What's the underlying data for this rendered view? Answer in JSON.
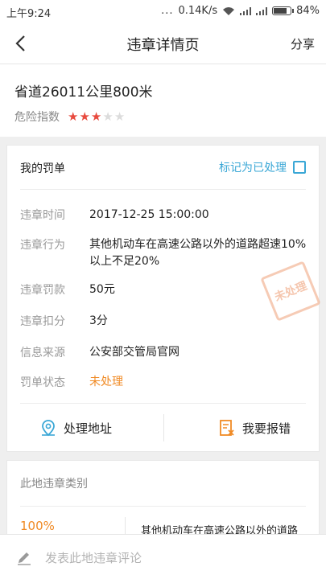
{
  "status_bar": {
    "time": "上午9:24",
    "dots": "...",
    "speed": "0.14K/s",
    "battery": "84%",
    "battery_level": 0.84
  },
  "nav": {
    "title": "违章详情页",
    "share": "分享"
  },
  "location": {
    "name": "省道26011公里800米",
    "risk_label": "危险指数",
    "risk_level": 3,
    "risk_max": 5
  },
  "ticket": {
    "header": "我的罚单",
    "mark_label": "标记为已处理",
    "stamp": "未处理",
    "rows": [
      {
        "label": "违章时间",
        "value": "2017-12-25 15:00:00"
      },
      {
        "label": "违章行为",
        "value": "其他机动车在高速公路以外的道路超速10%以上不足20%"
      },
      {
        "label": "违章罚款",
        "value": "50元"
      },
      {
        "label": "违章扣分",
        "value": "3分"
      },
      {
        "label": "信息来源",
        "value": "公安部交管局官网"
      },
      {
        "label": "罚单状态",
        "value": "未处理"
      }
    ],
    "actions": {
      "address": "处理地址",
      "report": "我要报错"
    }
  },
  "category": {
    "header": "此地违章类别",
    "percent": "100%",
    "desc": "其他机动车在高速公路以外的道路"
  },
  "comment": {
    "placeholder": "发表此地违章评论"
  },
  "colors": {
    "accent": "#3aa7d6",
    "warn": "#f08a24",
    "star": "#e84a3e"
  }
}
